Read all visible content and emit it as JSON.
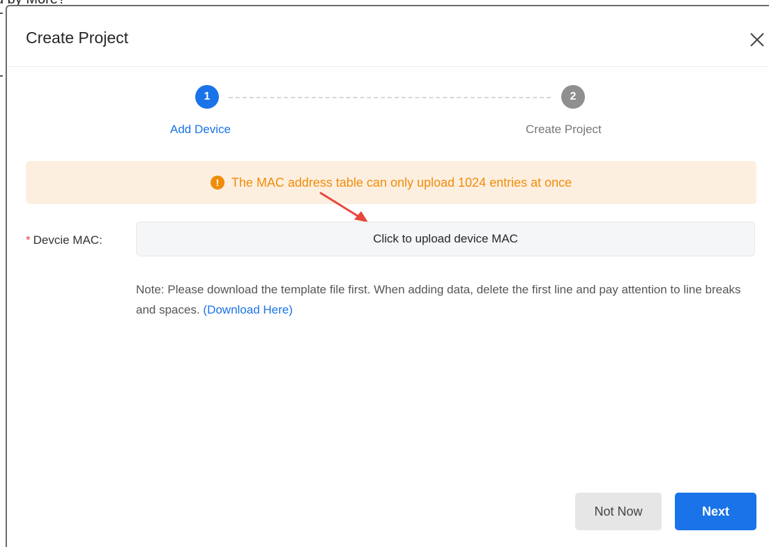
{
  "background": {
    "text": "d by More?"
  },
  "modal": {
    "title": "Create Project"
  },
  "steps": [
    {
      "number": "1",
      "label": "Add Device"
    },
    {
      "number": "2",
      "label": "Create Project"
    }
  ],
  "alert": {
    "icon": "!",
    "text": "The MAC address table can only upload 1024 entries at once"
  },
  "form": {
    "required_mark": "*",
    "label": "Devcie MAC:",
    "upload_label": "Click to upload device MAC"
  },
  "note": {
    "text": "Note: Please download the template file first. When adding data, delete the first line and pay attention to line breaks and spaces. ",
    "link": "(Download Here)"
  },
  "footer": {
    "not_now_label": "Not Now",
    "next_label": "Next"
  },
  "colors": {
    "primary": "#1a73e8",
    "step_inactive": "#8f8f8f",
    "warning": "#f08c0a",
    "warning_bg": "#fdefe0",
    "annotation_arrow": "#e8473f"
  },
  "icons": {
    "close": "close-icon",
    "alert": "exclamation-circle-icon"
  }
}
